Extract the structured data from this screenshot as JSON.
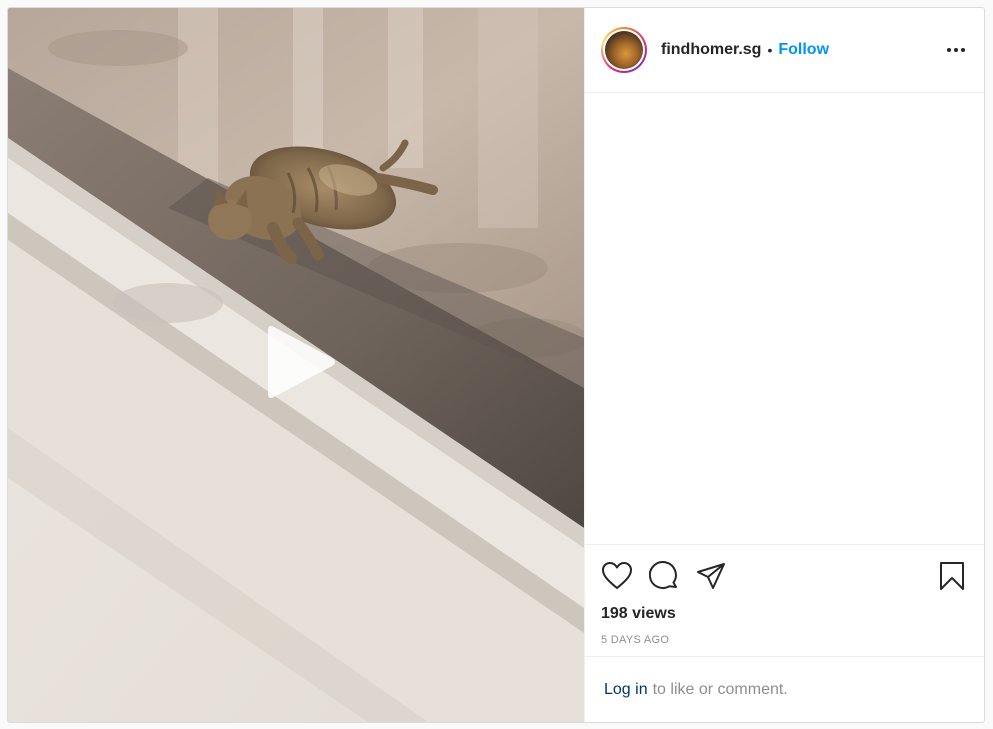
{
  "post": {
    "author": {
      "username": "findhomer.sg",
      "separator": "•",
      "follow_label": "Follow"
    },
    "media": {
      "type": "video",
      "play_icon": "play-icon"
    },
    "actions": {
      "like_icon": "heart-icon",
      "comment_icon": "comment-icon",
      "share_icon": "paper-plane-icon",
      "save_icon": "bookmark-icon"
    },
    "views": "198 views",
    "timestamp": "5 DAYS AGO",
    "login_prompt": {
      "link_label": "Log in",
      "suffix": "to like or comment."
    },
    "colors": {
      "accent": "#0095f6",
      "link": "#00376b",
      "muted": "#8e8e8e",
      "text": "#262626"
    }
  }
}
